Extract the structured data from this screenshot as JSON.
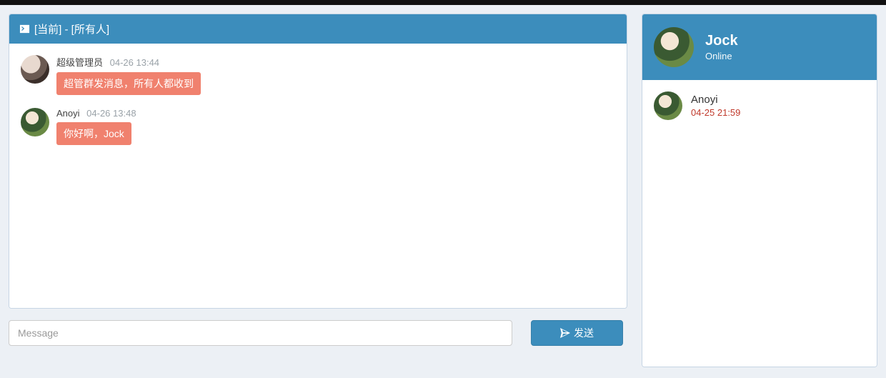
{
  "chat": {
    "header": {
      "icon": "terminal-icon",
      "title": "[当前] - [所有人]"
    },
    "messages": [
      {
        "sender": "超级管理员",
        "time": "04-26 13:44",
        "text": "超管群发消息，所有人都收到",
        "avatar": "av-admin"
      },
      {
        "sender": "Anoyi",
        "time": "04-26 13:48",
        "text": "你好啊，Jock",
        "avatar": "av-anoyi"
      }
    ],
    "composer": {
      "placeholder": "Message",
      "value": "",
      "send_label": "发送"
    }
  },
  "profile": {
    "name": "Jock",
    "status": "Online",
    "avatar": "av-jock"
  },
  "contacts": [
    {
      "name": "Anoyi",
      "time": "04-25 21:59",
      "avatar": "av-anoyi"
    }
  ]
}
